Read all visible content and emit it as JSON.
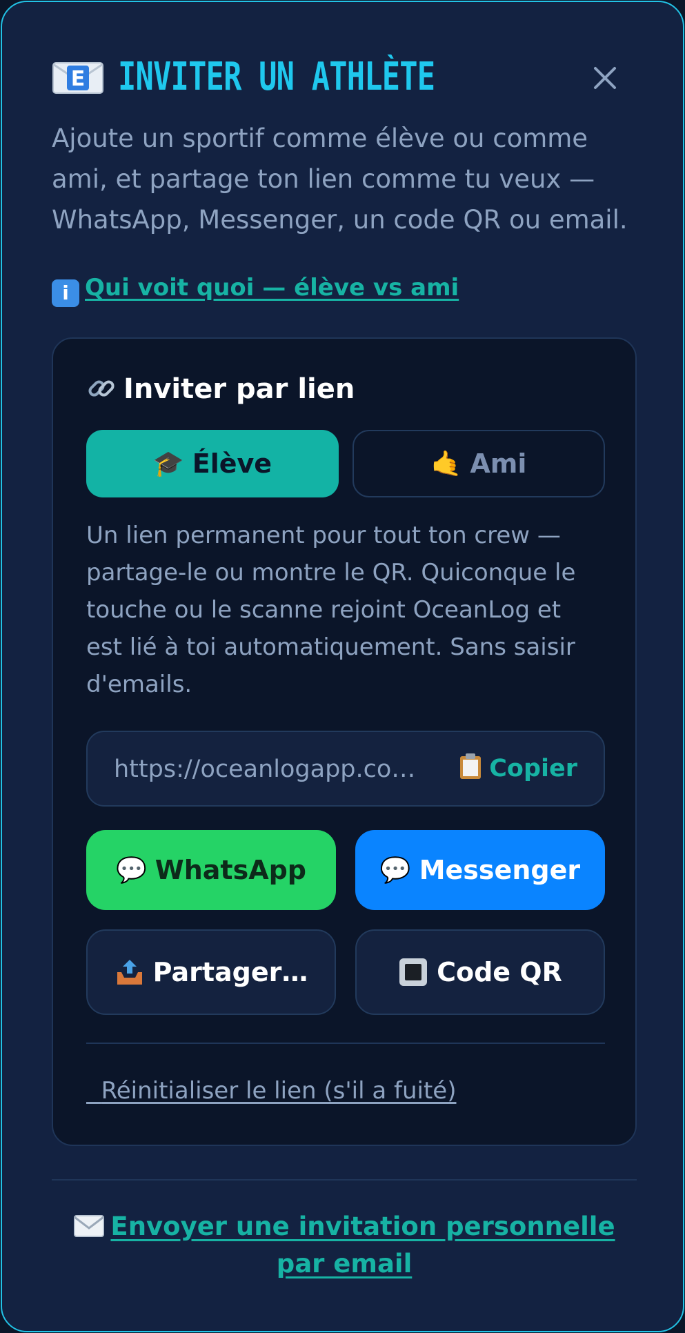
{
  "modal": {
    "title": "INVITER UN ATHLÈTE",
    "title_icon": "e-mail-icon",
    "close_icon": "close-icon",
    "subtitle": "Ajoute un sportif comme élève ou comme ami, et partage ton lien comme tu veux — WhatsApp, Messenger, un code QR ou email.",
    "info_link": "Qui voit quoi — élève vs ami",
    "info_icon": "info-icon"
  },
  "card": {
    "title": "Inviter par lien",
    "title_icon": "link-icon",
    "tabs": [
      {
        "label": "Élève",
        "icon": "graduation-cap-icon",
        "active": true
      },
      {
        "label": "Ami",
        "icon": "call-me-hand-icon",
        "active": false
      }
    ],
    "description": "Un lien permanent pour tout ton crew — partage-le ou montre le QR. Quiconque le touche ou le scanne rejoint OceanLog et est lié à toi automatiquement. Sans saisir d'emails.",
    "url_value": "https://oceanlogapp.com/j…",
    "copy_label": "Copier",
    "copy_icon": "clipboard-icon",
    "buttons": {
      "whatsapp": "WhatsApp",
      "messenger": "Messenger",
      "share": "Partager…",
      "qr": "Code QR"
    },
    "reset_link": "Réinitialiser le lien (s'il a fuité)"
  },
  "footer": {
    "email_link": "Envoyer une invitation personnelle par email",
    "email_icon": "envelope-icon"
  },
  "colors": {
    "accent": "#17b3a4",
    "title": "#1fc8ee",
    "whatsapp": "#25d366",
    "messenger": "#0a84ff",
    "background": "#132241"
  }
}
